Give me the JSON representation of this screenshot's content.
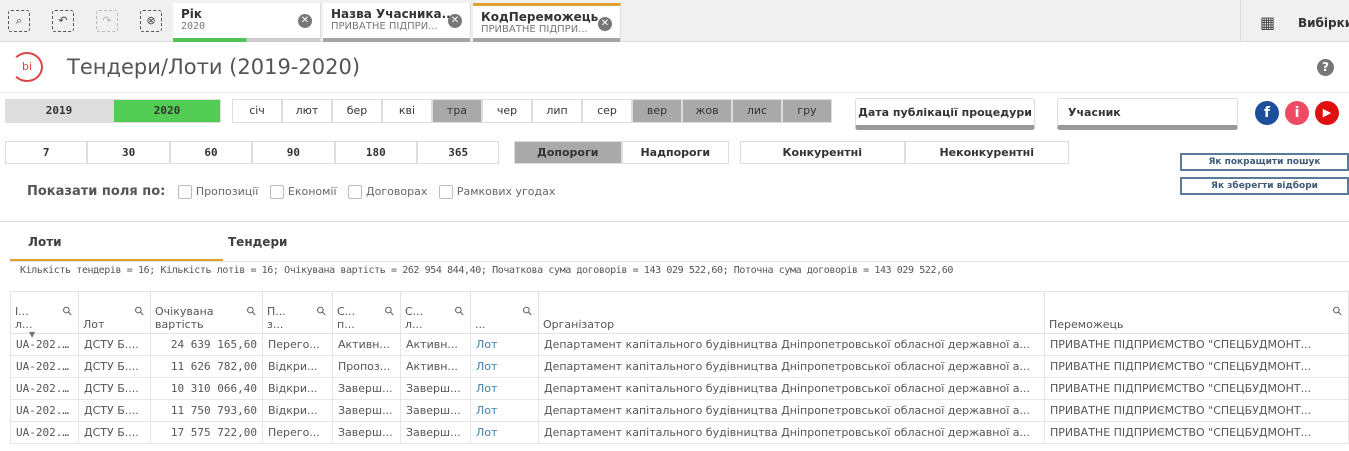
{
  "toolbar": {
    "selections_label": "Вибірки"
  },
  "selection_tabs": [
    {
      "title": "Рік",
      "value": "2020"
    },
    {
      "title": "Назва Учасника...",
      "value": "ПРИВАТНЕ ПІДПРИ..."
    },
    {
      "title": "КодПереможець",
      "value": "ПРИВАТНЕ ПІДПРИ..."
    }
  ],
  "header": {
    "title": "Тендери/Лоти (2019-2020)",
    "help": "?",
    "logo": "bi"
  },
  "years": [
    {
      "label": "2019",
      "selected": false
    },
    {
      "label": "2020",
      "selected": true
    }
  ],
  "months": [
    {
      "label": "січ",
      "state": "white"
    },
    {
      "label": "лют",
      "state": "white"
    },
    {
      "label": "бер",
      "state": "white"
    },
    {
      "label": "кві",
      "state": "white"
    },
    {
      "label": "тра",
      "state": "gray"
    },
    {
      "label": "чер",
      "state": "white"
    },
    {
      "label": "лип",
      "state": "white"
    },
    {
      "label": "сер",
      "state": "white"
    },
    {
      "label": "вер",
      "state": "gray"
    },
    {
      "label": "жов",
      "state": "gray"
    },
    {
      "label": "лис",
      "state": "gray"
    },
    {
      "label": "гру",
      "state": "gray"
    }
  ],
  "filters": {
    "date_pub": "Дата публікації процедури",
    "participant": "Учасник"
  },
  "days": [
    "7",
    "30",
    "60",
    "90",
    "180",
    "365"
  ],
  "thresholds": [
    "Допороги",
    "Надпороги"
  ],
  "competition": [
    "Конкурентні",
    "Неконкурентні"
  ],
  "help_links": [
    "Як покращити пошук",
    "Як зберегти відбори"
  ],
  "show_fields": {
    "label": "Показати поля по:",
    "options": [
      "Пропозиції",
      "Економії",
      "Договорах",
      "Рамкових угодах"
    ]
  },
  "tabs": [
    "Лоти",
    "Тендери"
  ],
  "summary": "Кількість тендерів = 16; Кількість лотів = 16; Очікувана вартість = 262 954 844,40; Початкова сума договорів = 143 029 522,60; Поточна сума договорів = 143 029 522,60",
  "table": {
    "headers": [
      [
        "І...",
        "л..."
      ],
      [
        "",
        "Лот"
      ],
      [
        "Очікувана",
        "вартість"
      ],
      [
        "П...",
        "з..."
      ],
      [
        "С...",
        "п..."
      ],
      [
        "С...",
        "л..."
      ],
      [
        "",
        "..."
      ],
      [
        "",
        "Організатор"
      ],
      [
        "",
        "Переможець"
      ]
    ],
    "rows": [
      [
        "UA-202...",
        "ДСТУ Б....",
        "24 639 165,60",
        "Перего...",
        "Активн...",
        "Активн...",
        "Лот",
        "Департамент капітального будівництва Дніпропетровської обласної державної а...",
        "ПРИВАТНЕ ПІДПРИЄМСТВО \"СПЕЦБУДМОНТ..."
      ],
      [
        "UA-202...",
        "ДСТУ Б....",
        "11 626 782,00",
        "Відкри...",
        "Пропоз...",
        "Активн...",
        "Лот",
        "Департамент капітального будівництва Дніпропетровської обласної державної а...",
        "ПРИВАТНЕ ПІДПРИЄМСТВО \"СПЕЦБУДМОНТ..."
      ],
      [
        "UA-202...",
        "ДСТУ Б....",
        "10 310 066,40",
        "Відкри...",
        "Заверш...",
        "Заверш...",
        "Лот",
        "Департамент капітального будівництва Дніпропетровської обласної державної а...",
        "ПРИВАТНЕ ПІДПРИЄМСТВО \"СПЕЦБУДМОНТ..."
      ],
      [
        "UA-202...",
        "ДСТУ Б....",
        "11 750 793,60",
        "Відкри...",
        "Заверш...",
        "Заверш...",
        "Лот",
        "Департамент капітального будівництва Дніпропетровської обласної державної а...",
        "ПРИВАТНЕ ПІДПРИЄМСТВО \"СПЕЦБУДМОНТ..."
      ],
      [
        "UA-202...",
        "ДСТУ Б....",
        "17 575 722,00",
        "Перего...",
        "Заверш...",
        "Заверш...",
        "Лот",
        "Департамент капітального будівництва Дніпропетровської обласної державної а...",
        "ПРИВАТНЕ ПІДПРИЄМСТВО \"СПЕЦБУДМОНТ..."
      ]
    ]
  }
}
